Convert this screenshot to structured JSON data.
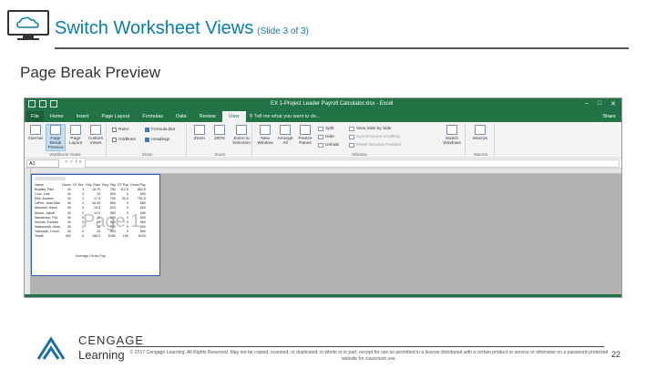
{
  "slide": {
    "title": "Switch Worksheet Views",
    "title_suffix": "(Slide 3 of 3)",
    "subtitle": "Page Break Preview",
    "copyright": "© 2017 Cengage Learning. All Rights Reserved. May not be copied, scanned, or duplicated, in whole or in part, except for use as permitted in a license distributed with a certain product or service or otherwise on a password-protected website for classroom use.",
    "page_number": "22",
    "logo": {
      "line1": "CENGAGE",
      "line2": "Learning",
      "brand_color": "#1a6fa0"
    }
  },
  "excel": {
    "window_title": "EX 1-Project Leader Payroll Calculator.xlsx - Excel",
    "theme_color": "#217346",
    "tabs": [
      "File",
      "Home",
      "Insert",
      "Page Layout",
      "Formulas",
      "Data",
      "Review",
      "View"
    ],
    "active_tab": "View",
    "tell_me": "Tell me what you want to do...",
    "user": "",
    "share": "Share",
    "ribbon": {
      "workbook_views": {
        "label": "Workbook Views",
        "buttons": [
          "Normal",
          "Page Break Preview",
          "Page Layout",
          "Custom Views"
        ]
      },
      "show": {
        "label": "Show",
        "items": [
          {
            "label": "Ruler",
            "checked": false
          },
          {
            "label": "Formula Bar",
            "checked": true
          },
          {
            "label": "Gridlines",
            "checked": false
          },
          {
            "label": "Headings",
            "checked": true
          }
        ]
      },
      "zoom": {
        "label": "Zoom",
        "buttons": [
          "Zoom",
          "100%",
          "Zoom to Selection"
        ]
      },
      "window": {
        "label": "Window",
        "buttons": [
          "New Window",
          "Arrange All",
          "Freeze Panes"
        ],
        "small": [
          "Split",
          "Hide",
          "Unhide",
          "View Side by Side",
          "Synchronous Scrolling",
          "Reset Window Position"
        ],
        "switch": "Switch Windows"
      },
      "macros": {
        "label": "Macros",
        "button": "Macros"
      }
    },
    "name_box": "A1",
    "page_watermark": "Page 1",
    "table": {
      "headers": [
        "Name",
        "Hours",
        "OT Hrs.",
        "Hrly. Rate",
        "Reg. Pay",
        "OT Pay",
        "Gross Pay"
      ],
      "rows": [
        [
          "Bradley, Pam",
          "40",
          "4",
          "18.75",
          "750",
          "112.5",
          "862.5"
        ],
        [
          "Cruz, Lola",
          "40",
          "0",
          "15",
          "600",
          "0",
          "600"
        ],
        [
          "Ellis, Andrew",
          "40",
          "2",
          "17.5",
          "700",
          "52.5",
          "752.5"
        ],
        [
          "LaPier, Jean-Mae",
          "40",
          "0",
          "16.25",
          "650",
          "0",
          "650"
        ],
        [
          "Marshall, Hazel",
          "40",
          "0",
          "15.5",
          "620",
          "0",
          "620"
        ],
        [
          "Moore, Jakob",
          "40",
          "0",
          "14.5",
          "580",
          "0",
          "580"
        ],
        [
          "Sanderson, Pat",
          "40",
          "0",
          "15",
          "600",
          "0",
          "600"
        ],
        [
          "Shields, Freddie",
          "40",
          "0",
          "14",
          "560",
          "0",
          "560"
        ],
        [
          "Wadsworth, Alma",
          "40",
          "0",
          "15",
          "600",
          "0",
          "600"
        ],
        [
          "Yarmouth, Lionel",
          "40",
          "0",
          "15",
          "600",
          "0",
          "600"
        ],
        [
          "Totals",
          "400",
          "6",
          "156.5",
          "6260",
          "165",
          "6425"
        ]
      ]
    },
    "chart_caption": "Average Gross Pay"
  }
}
